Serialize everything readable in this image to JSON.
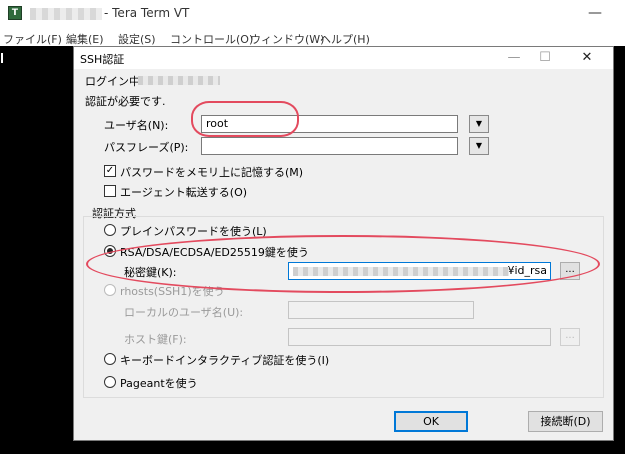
{
  "window": {
    "title": "- Tera Term VT",
    "icon": "tera-term-app-icon",
    "minimize_glyph": "—"
  },
  "menu": [
    "ファイル(F)",
    "編集(E)",
    "設定(S)",
    "コントロール(O)",
    "ウィンドウ(W)",
    "ヘルプ(H)"
  ],
  "dialog": {
    "title": "SSH認証",
    "controls": {
      "minimize": "—",
      "maximize": "☐",
      "close": "✕"
    },
    "login_prefix": "ログイン中:",
    "auth_required": "認証が必要です.",
    "username_label": "ユーザ名(N):",
    "username_value": "root",
    "passphrase_label": "パスフレーズ(P):",
    "passphrase_value": "",
    "remember_password_label": "パスワードをメモリ上に記憶する(M)",
    "remember_password_checked": true,
    "agent_forward_label": "エージェント転送する(O)",
    "agent_forward_checked": false,
    "auth_method_group": "認証方式",
    "methods": {
      "plain": "プレインパスワードを使う(L)",
      "rsa": "RSA/DSA/ECDSA/ED25519鍵を使う",
      "rhosts": "rhosts(SSH1)を使う",
      "keyboard_interactive": "キーボードインタラクティブ認証を使う(I)",
      "pageant": "Pageantを使う"
    },
    "selected_method": "rsa",
    "private_key_label": "秘密鍵(K):",
    "private_key_value": "¥id_rsa",
    "browse_label": "...",
    "local_username_label": "ローカルのユーザ名(U):",
    "host_key_label": "ホスト鍵(F):",
    "ok_label": "OK",
    "disconnect_label": "接続断(D)",
    "accent": "#0078d7",
    "highlight_color": "#e34a5e"
  }
}
